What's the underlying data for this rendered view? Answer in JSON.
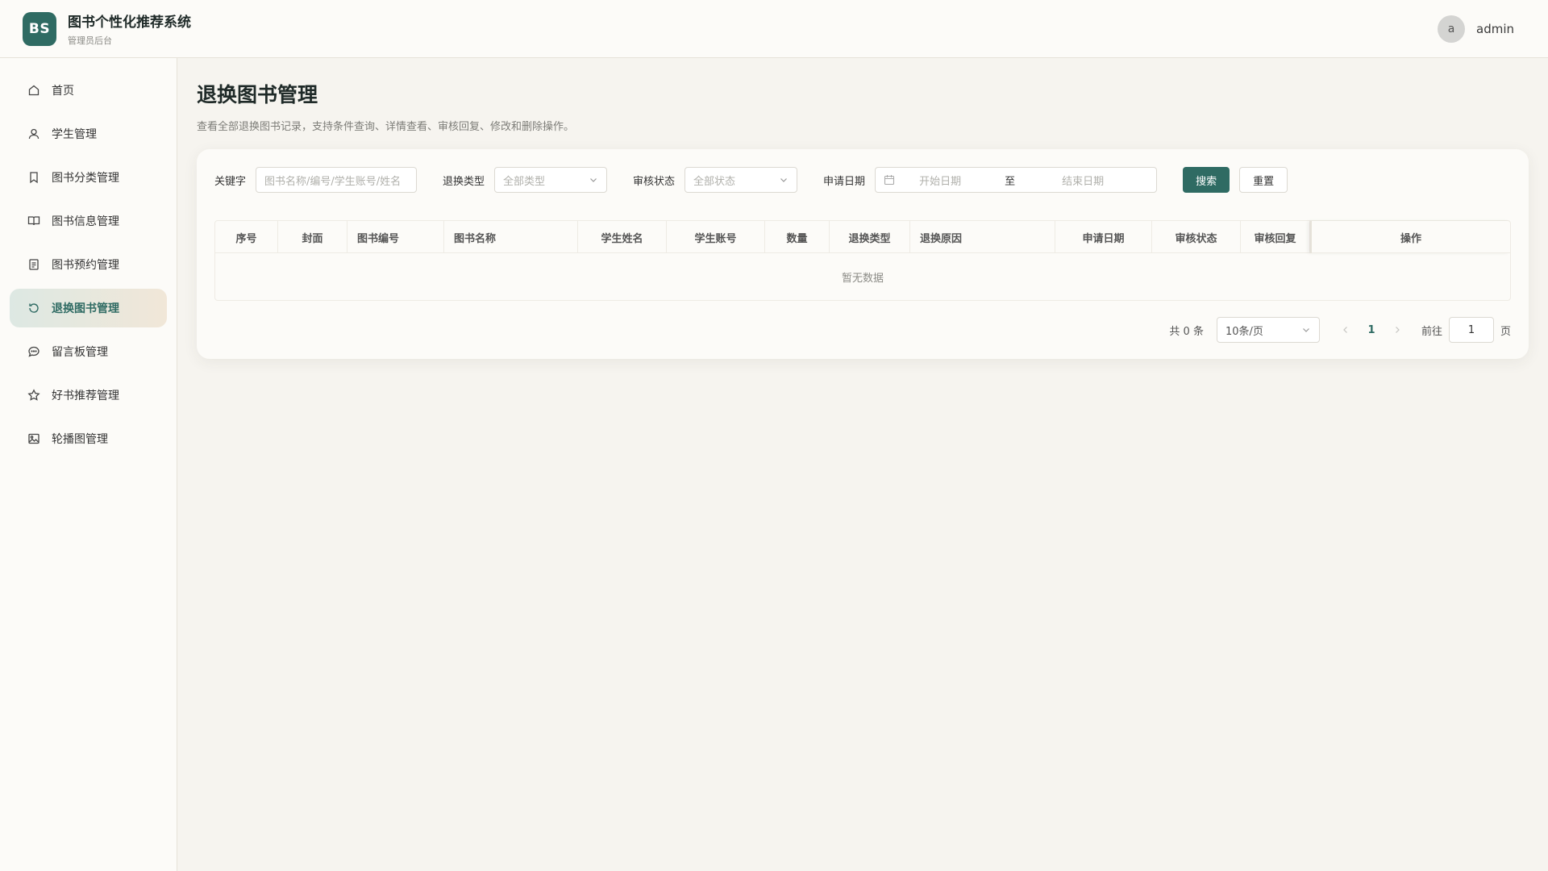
{
  "header": {
    "logo_text": "BS",
    "title": "图书个性化推荐系统",
    "subtitle": "管理员后台",
    "avatar_letter": "a",
    "username": "admin"
  },
  "sidebar": {
    "items": [
      {
        "label": "首页",
        "icon": "home-icon"
      },
      {
        "label": "学生管理",
        "icon": "user-icon"
      },
      {
        "label": "图书分类管理",
        "icon": "bookmark-icon"
      },
      {
        "label": "图书信息管理",
        "icon": "book-open-icon"
      },
      {
        "label": "图书预约管理",
        "icon": "document-icon"
      },
      {
        "label": "退换图书管理",
        "icon": "refresh-icon",
        "active": true
      },
      {
        "label": "留言板管理",
        "icon": "message-icon"
      },
      {
        "label": "好书推荐管理",
        "icon": "star-icon"
      },
      {
        "label": "轮播图管理",
        "icon": "image-icon"
      }
    ]
  },
  "page": {
    "title": "退换图书管理",
    "description": "查看全部退换图书记录，支持条件查询、详情查看、审核回复、修改和删除操作。"
  },
  "filters": {
    "keyword_label": "关键字",
    "keyword_placeholder": "图书名称/编号/学生账号/姓名",
    "type_label": "退换类型",
    "type_value": "全部类型",
    "status_label": "审核状态",
    "status_value": "全部状态",
    "date_label": "申请日期",
    "date_start": "开始日期",
    "date_sep": "至",
    "date_end": "结束日期",
    "search_button": "搜索",
    "reset_button": "重置"
  },
  "table": {
    "columns": [
      "序号",
      "封面",
      "图书编号",
      "图书名称",
      "学生姓名",
      "学生账号",
      "数量",
      "退换类型",
      "退换原因",
      "申请日期",
      "审核状态",
      "审核回复",
      "操作"
    ],
    "empty_text": "暂无数据"
  },
  "pagination": {
    "total_text": "共 0 条",
    "page_size": "10条/页",
    "current_page": "1",
    "goto_label": "前往",
    "goto_value": "1",
    "page_unit": "页"
  },
  "colors": {
    "accent": "#2f6b63",
    "background": "#f6f4ef",
    "surface": "#fcfbf8"
  }
}
